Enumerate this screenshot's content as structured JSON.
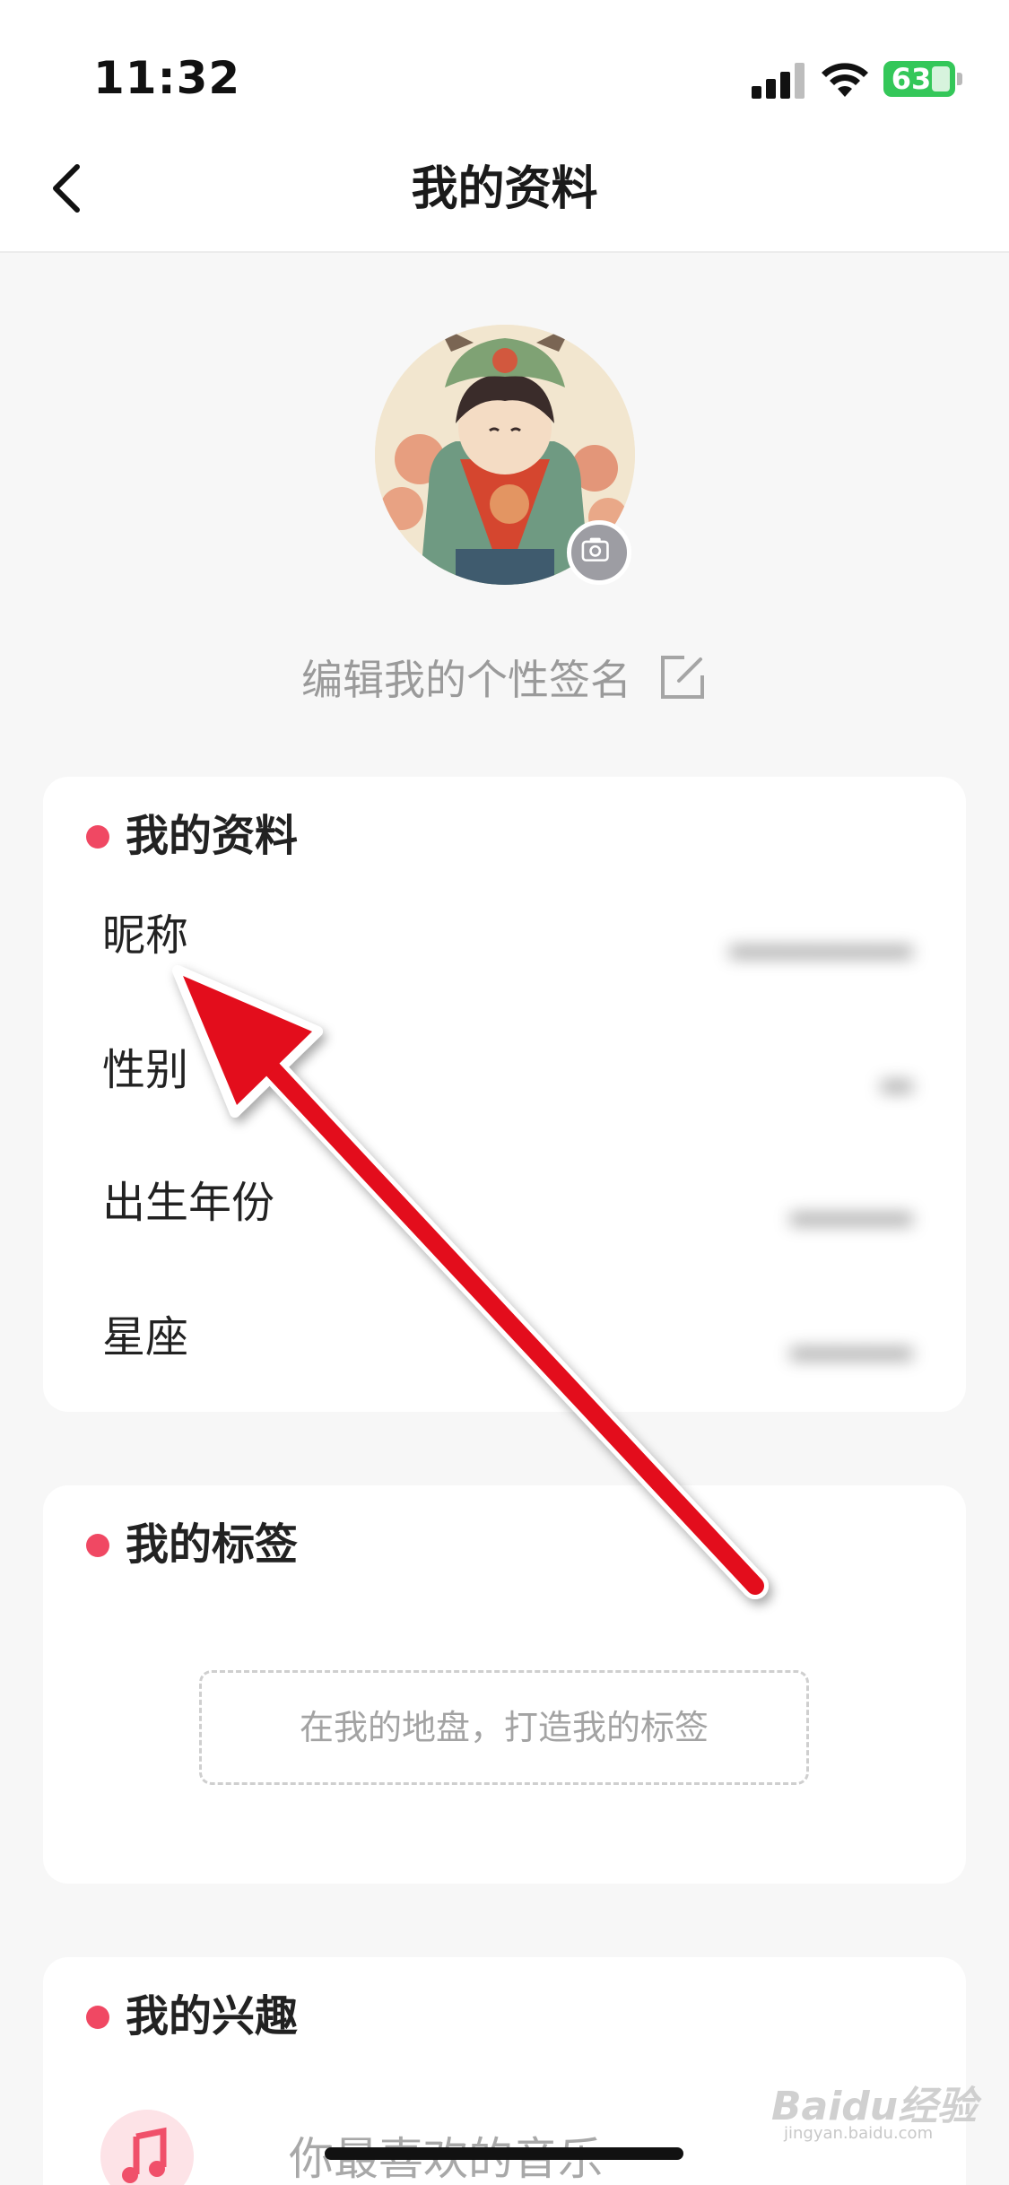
{
  "status_bar": {
    "time": "11:32",
    "battery": "63",
    "icons": [
      "signal-icon",
      "wifi-icon",
      "battery-charging-icon"
    ]
  },
  "nav": {
    "title": "我的资料",
    "back_icon": "chevron-left-icon"
  },
  "profile": {
    "camera_icon": "camera-icon",
    "signature_placeholder": "编辑我的个性签名",
    "edit_icon": "edit-icon"
  },
  "profile_card": {
    "title": "我的资料",
    "rows": [
      {
        "label": "昵称"
      },
      {
        "label": "性别"
      },
      {
        "label": "出生年份"
      },
      {
        "label": "星座"
      }
    ]
  },
  "tags_card": {
    "title": "我的标签",
    "placeholder": "在我的地盘，打造我的标签"
  },
  "interests_card": {
    "title": "我的兴趣",
    "music_label": "你最喜欢的音乐",
    "music_icon": "music-note-icon"
  },
  "watermark": {
    "text": "Baidu经验",
    "sub": "jingyan.baidu.com"
  },
  "colors": {
    "accent_dot": "#f04863",
    "annotation_arrow": "#e3101a",
    "battery": "#34c759"
  }
}
